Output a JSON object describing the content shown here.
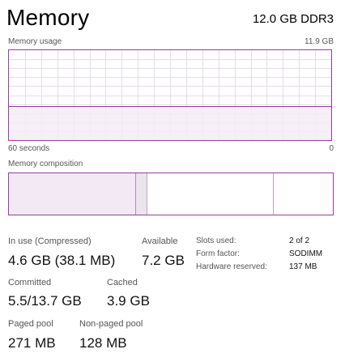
{
  "header": {
    "title": "Memory",
    "spec": "12.0 GB DDR3"
  },
  "usage_graph": {
    "label": "Memory usage",
    "max_label": "11.9 GB",
    "time_label": "60 seconds",
    "min_label": "0",
    "fraction_used": 0.38,
    "line_color": "#9c3aa3",
    "fill_color": "#f4ecf5",
    "grid_color": "#e6dbe8"
  },
  "composition": {
    "label": "Memory composition",
    "in_use_fraction": 0.388,
    "modified_fraction": 0.037,
    "standby_fraction": 0.388,
    "free_fraction": 0.187
  },
  "stats": {
    "in_use": {
      "label": "In use (Compressed)",
      "value": "4.6 GB (38.1 MB)"
    },
    "available": {
      "label": "Available",
      "value": "7.2 GB"
    },
    "committed": {
      "label": "Committed",
      "value": "5.5/13.7 GB"
    },
    "cached": {
      "label": "Cached",
      "value": "3.9 GB"
    },
    "paged_pool": {
      "label": "Paged pool",
      "value": "271 MB"
    },
    "non_paged_pool": {
      "label": "Non-paged pool",
      "value": "128 MB"
    }
  },
  "hardware": {
    "slots": {
      "label": "Slots used:",
      "value": "2 of 2"
    },
    "form_factor": {
      "label": "Form factor:",
      "value": "SODIMM"
    },
    "reserved": {
      "label": "Hardware reserved:",
      "value": "137 MB"
    }
  }
}
